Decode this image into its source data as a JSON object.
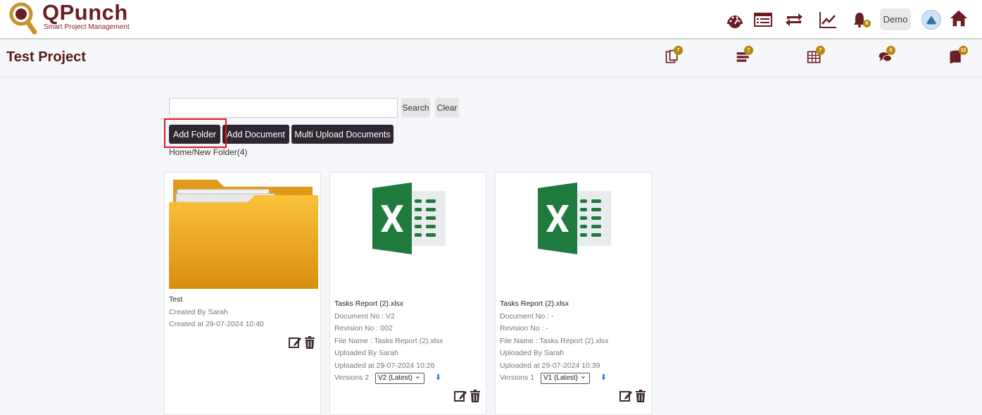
{
  "header": {
    "logo_title": "QPunch",
    "logo_subtitle": "Smart Project Management",
    "user_button": "Demo",
    "notification_count": "6",
    "icons": [
      "dashboard-icon",
      "list-icon",
      "sync-icon",
      "chart-icon",
      "bell-icon",
      "avatar",
      "home-icon"
    ]
  },
  "subheader": {
    "project_title": "Test Project",
    "items": [
      {
        "icon": "documents-icon",
        "count": "7"
      },
      {
        "icon": "tasks-icon",
        "count": "7"
      },
      {
        "icon": "calendar-icon",
        "count": "7"
      },
      {
        "icon": "chat-icon",
        "count": "0"
      },
      {
        "icon": "book-icon",
        "count": "12"
      }
    ]
  },
  "search": {
    "value": "",
    "search_label": "Search",
    "clear_label": "Clear"
  },
  "actions": {
    "add_folder": "Add Folder",
    "add_document": "Add Document",
    "multi_upload": "Multi Upload Documents"
  },
  "breadcrumb": {
    "home": "Home",
    "sep": "/",
    "current": "New Folder(4)"
  },
  "cards": [
    {
      "type": "folder",
      "name": "Test",
      "created_by": "Created By Sarah",
      "created_at": "Created at 29-07-2024 10:40"
    },
    {
      "type": "document",
      "name": "Tasks Report (2).xlsx",
      "document_no": "Document No : V2",
      "revision_no": "Revision No : 002",
      "file_name": "File Name : Tasks Report (2).xlsx",
      "uploaded_by": "Uploaded By Sarah",
      "uploaded_at": "Uploaded at 29-07-2024 10:26",
      "versions_label": "Versions 2",
      "version_selected": "V2 (Latest)"
    },
    {
      "type": "document",
      "name": "Tasks Report (2).xlsx",
      "document_no": "Document No : -",
      "revision_no": "Revision No : -",
      "file_name": "File Name : Tasks Report (2).xlsx",
      "uploaded_by": "Uploaded By Sarah",
      "uploaded_at": "Uploaded at 29-07-2024 10:39",
      "versions_label": "Versions 1",
      "version_selected": "V1 (Latest)"
    }
  ],
  "colors": {
    "brand": "#6b1d24",
    "dark_button": "#2e2630",
    "badge": "#b8860b",
    "excel_green": "#1f7a3e",
    "folder": "#f5b01e"
  }
}
